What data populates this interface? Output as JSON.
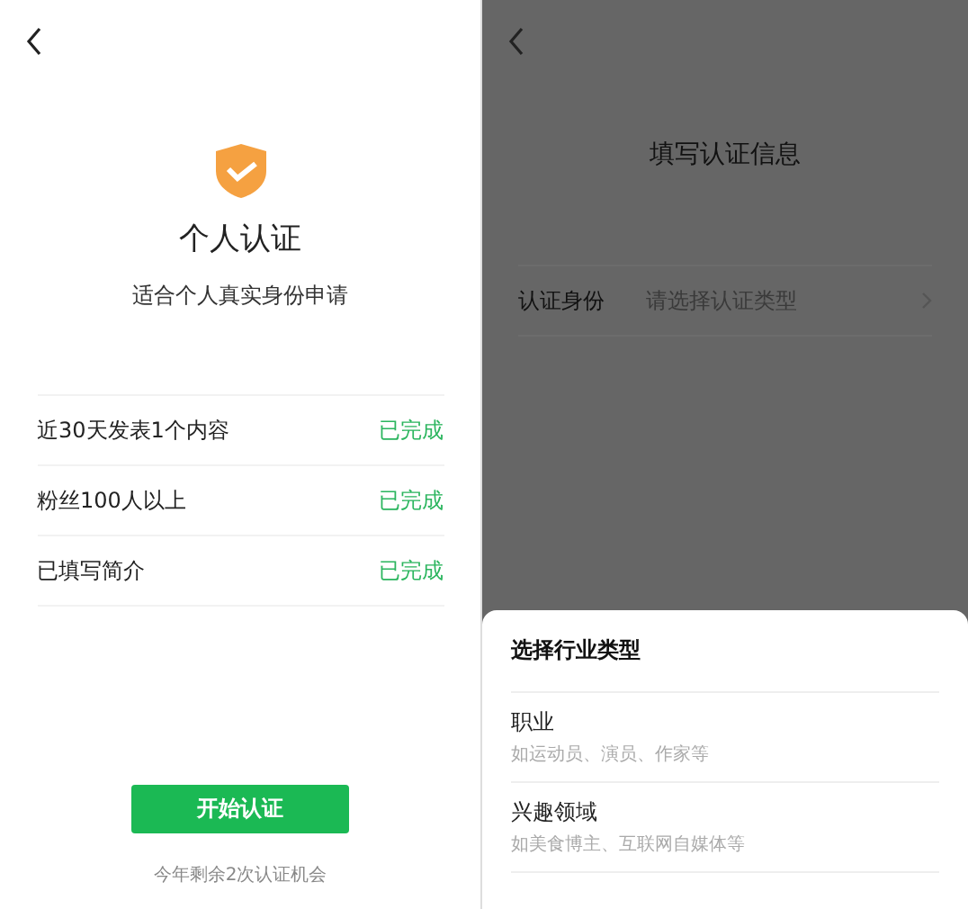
{
  "left": {
    "title": "个人认证",
    "subtitle": "适合个人真实身份申请",
    "requirements": [
      {
        "label": "近30天发表1个内容",
        "status": "已完成",
        "done": true
      },
      {
        "label": "粉丝100人以上",
        "status": "已完成",
        "done": true
      },
      {
        "label": "已填写简介",
        "status": "已完成",
        "done": true
      }
    ],
    "button": "开始认证",
    "footnote": "今年剩余2次认证机会"
  },
  "right": {
    "title": "填写认证信息",
    "field": {
      "label": "认证身份",
      "placeholder": "请选择认证类型"
    },
    "sheet": {
      "title": "选择行业类型",
      "options": [
        {
          "label": "职业",
          "hint": "如运动员、演员、作家等"
        },
        {
          "label": "兴趣领域",
          "hint": "如美食博主、互联网自媒体等"
        }
      ]
    }
  }
}
